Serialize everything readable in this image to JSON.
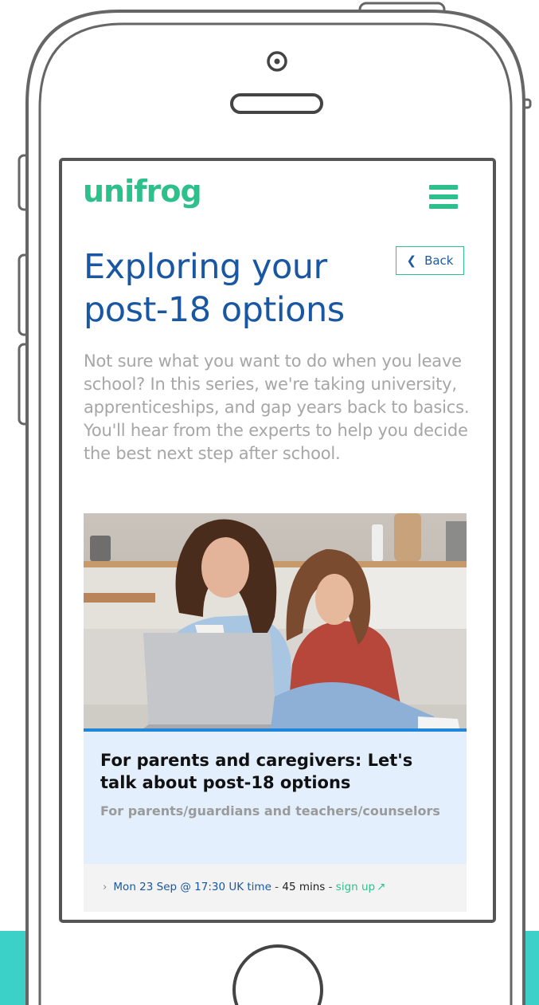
{
  "brand": {
    "logo_text": "unifrog",
    "accent_color": "#2dc08d",
    "title_color": "#1a57a2",
    "band_color": "#3bd1c8"
  },
  "header": {
    "menu_icon": "hamburger-menu-icon"
  },
  "nav": {
    "back_label": "Back",
    "back_icon": "chevron-left-icon"
  },
  "page": {
    "title": "Exploring your post-18 options",
    "intro": "Not sure what you want to do when you leave school? In this series, we're taking university, apprenticeships, and gap years back to basics. You'll hear from the experts to help you decide the best next step after school."
  },
  "event": {
    "image_description_icon": "photo-mother-daughter-laptop",
    "title": "For parents and caregivers: Let's talk about post-18 options",
    "audience": "For parents/guardians and teachers/counselors",
    "date": "Mon 23 Sep @ 17:30 UK time",
    "separator_1": " - ",
    "duration": "45 mins",
    "separator_2": " - ",
    "signup_label": "sign up",
    "signup_icon": "external-link-icon",
    "arrow_icon": "chevron-right-icon"
  }
}
